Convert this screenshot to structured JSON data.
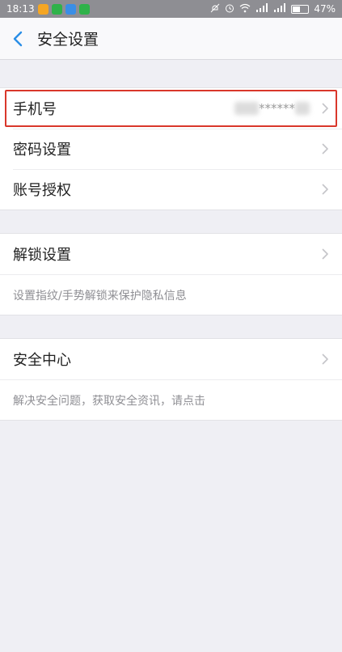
{
  "status_bar": {
    "time": "18:13",
    "battery": "47%",
    "battery_level": 0.47,
    "apps": [
      {
        "name": "weibo-icon",
        "color": "#f5a623"
      },
      {
        "name": "wechat-app-icon",
        "color": "#2fb24a"
      },
      {
        "name": "qq-icon",
        "color": "#3a8ee6"
      },
      {
        "name": "wechat-icon",
        "color": "#2fb24a"
      }
    ]
  },
  "header": {
    "title": "安全设置",
    "accent_color": "#2a8ee6"
  },
  "sections": {
    "account": {
      "phone_label": "手机号",
      "phone_value": "******",
      "password_label": "密码设置",
      "auth_label": "账号授权"
    },
    "unlock": {
      "label": "解锁设置",
      "desc": "设置指纹/手势解锁来保护隐私信息"
    },
    "security": {
      "label": "安全中心",
      "desc": "解决安全问题，获取安全资讯，请点击"
    }
  }
}
